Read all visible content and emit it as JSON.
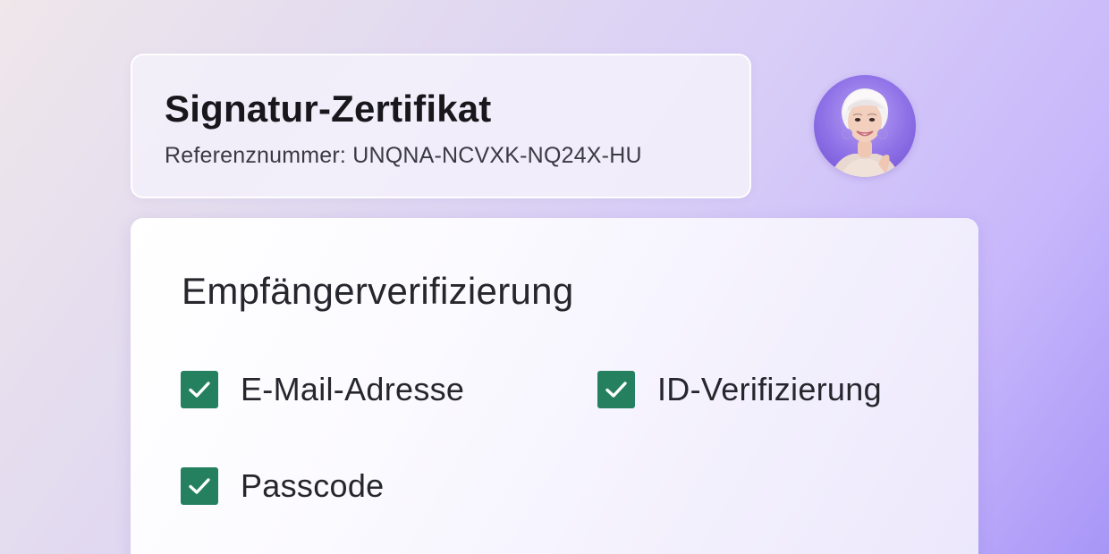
{
  "header": {
    "title": "Signatur-Zertifikat",
    "reference": "Referenznummer: UNQNA-NCVXK-NQ24X-HU"
  },
  "avatar": {
    "icon": "user-photo-avatar"
  },
  "verification": {
    "title": "Empfängerverifizierung",
    "items": [
      {
        "label": "E-Mail-Adresse",
        "checked": true
      },
      {
        "label": "ID-Verifizierung",
        "checked": true
      },
      {
        "label": "Passcode",
        "checked": true
      }
    ]
  },
  "colors": {
    "checkbox": "#258060",
    "accent": "#8d6fe6"
  }
}
